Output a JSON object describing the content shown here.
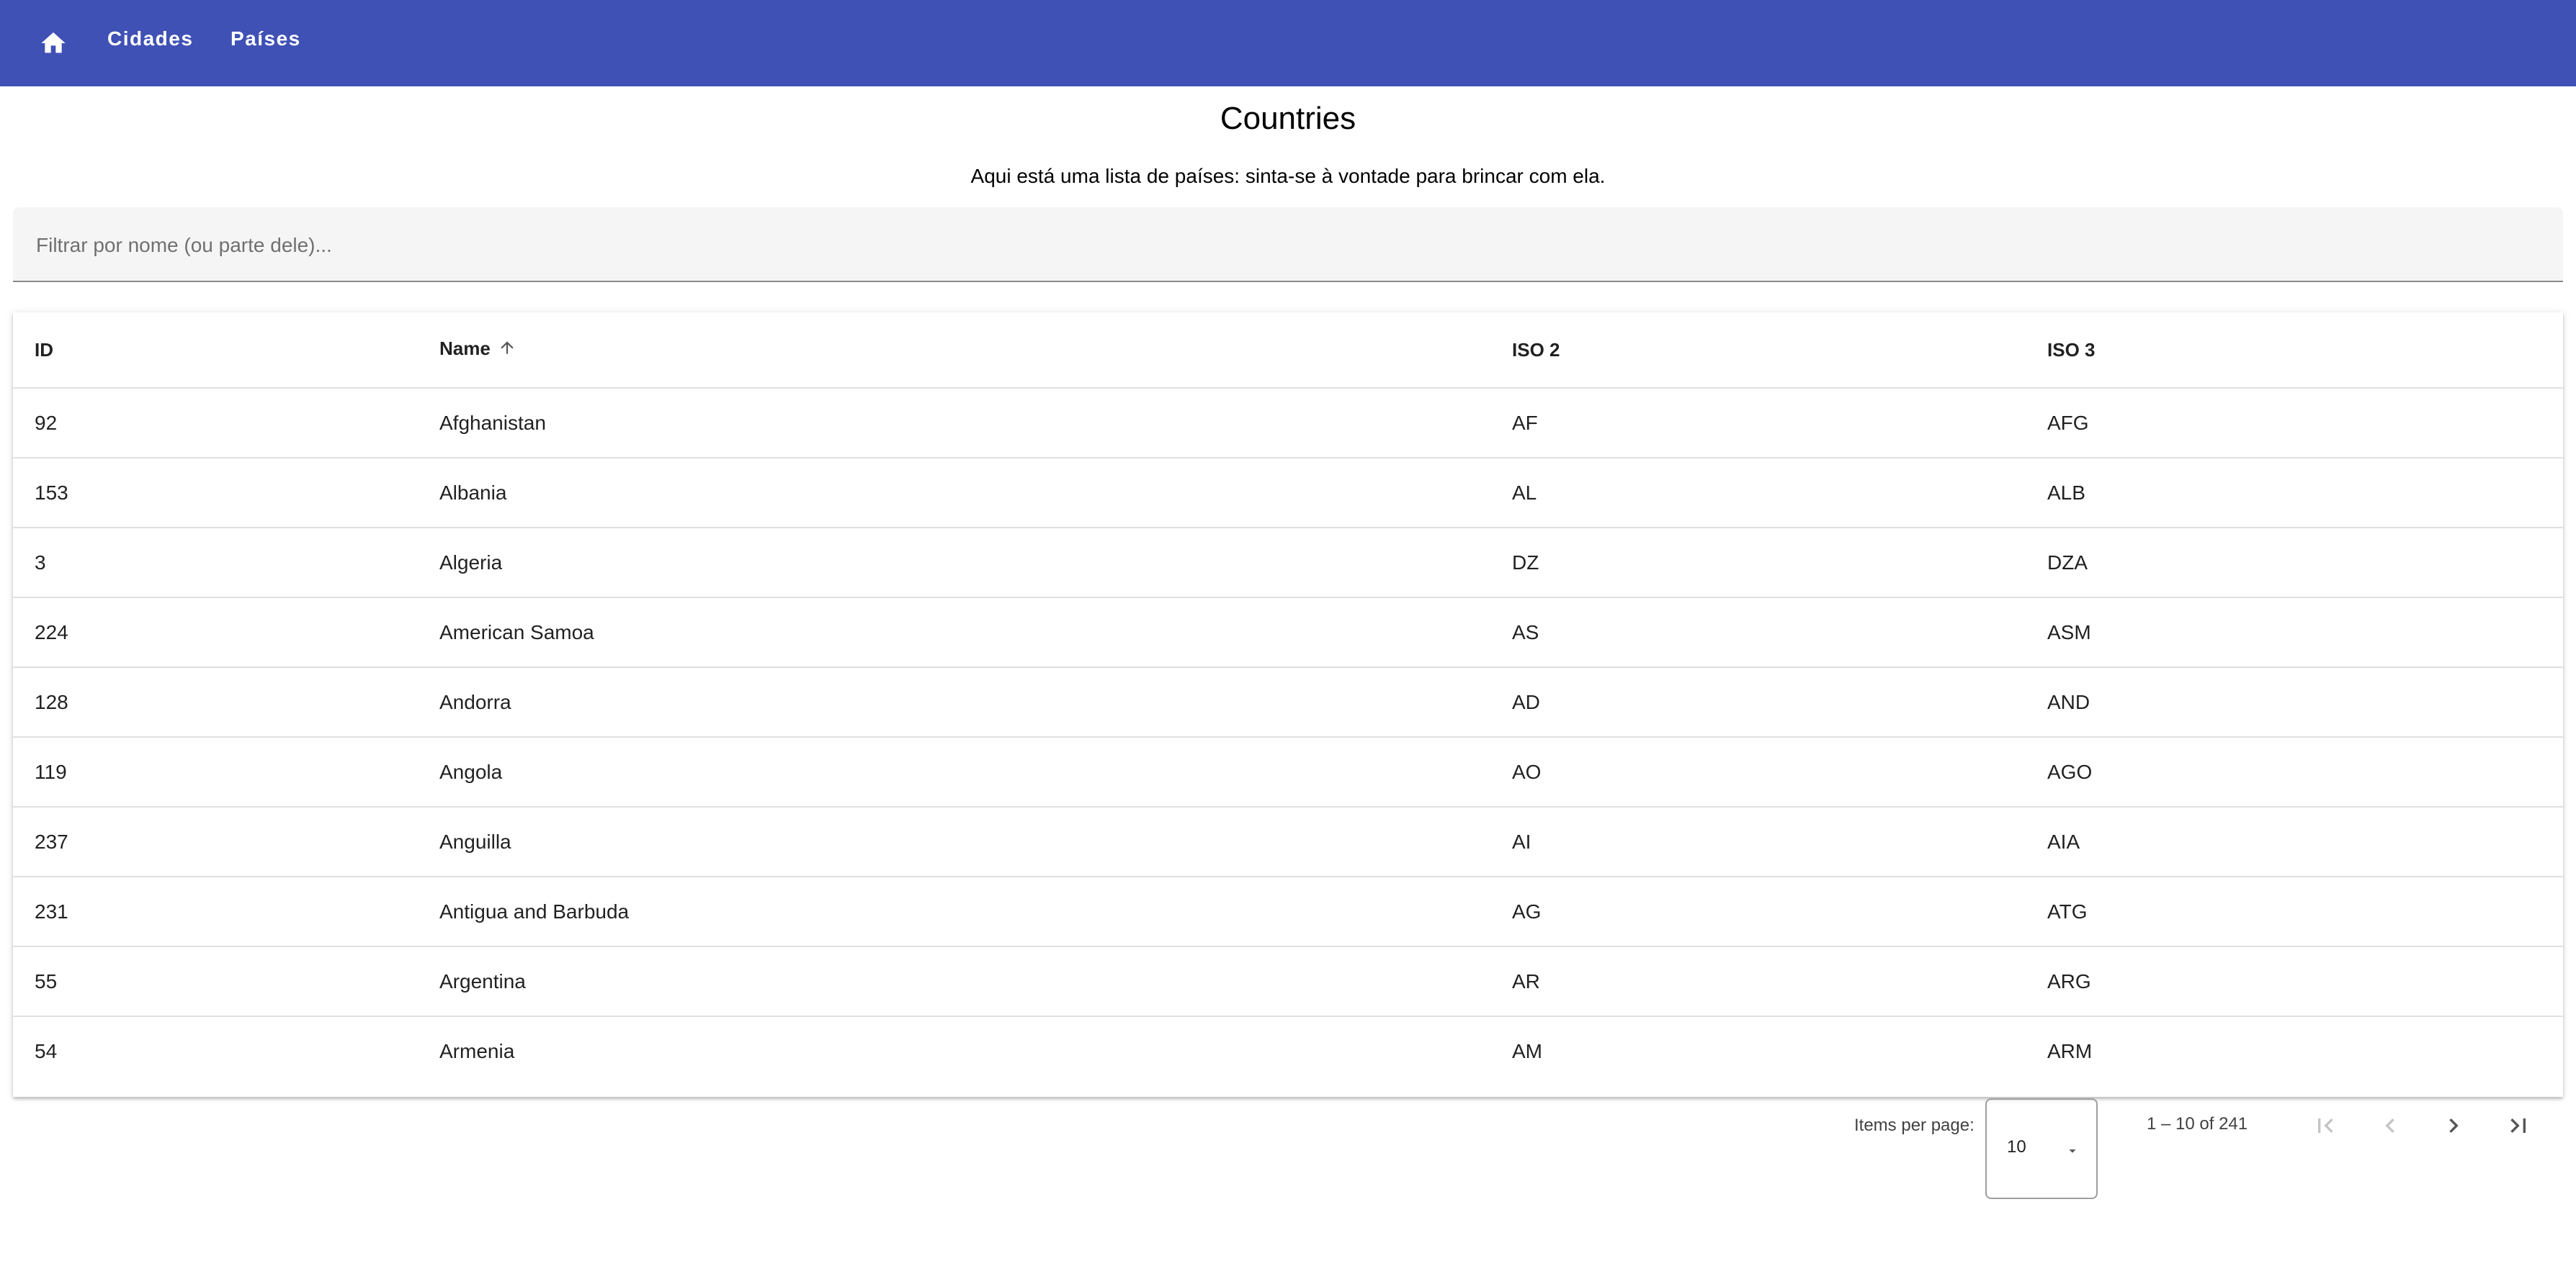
{
  "toolbar": {
    "home_icon": "home-icon",
    "links": [
      {
        "label": "Cidades"
      },
      {
        "label": "Países"
      }
    ]
  },
  "page": {
    "title": "Countries",
    "subtitle": "Aqui está uma lista de países: sinta-se à vontade para brincar com ela."
  },
  "filter": {
    "placeholder": "Filtrar por nome (ou parte dele)...",
    "value": ""
  },
  "table": {
    "columns": [
      "ID",
      "Name",
      "ISO 2",
      "ISO 3"
    ],
    "sort": {
      "column": "Name",
      "direction": "asc",
      "icon": "arrow-up-icon"
    },
    "rows": [
      {
        "id": "92",
        "name": "Afghanistan",
        "iso2": "AF",
        "iso3": "AFG"
      },
      {
        "id": "153",
        "name": "Albania",
        "iso2": "AL",
        "iso3": "ALB"
      },
      {
        "id": "3",
        "name": "Algeria",
        "iso2": "DZ",
        "iso3": "DZA"
      },
      {
        "id": "224",
        "name": "American Samoa",
        "iso2": "AS",
        "iso3": "ASM"
      },
      {
        "id": "128",
        "name": "Andorra",
        "iso2": "AD",
        "iso3": "AND"
      },
      {
        "id": "119",
        "name": "Angola",
        "iso2": "AO",
        "iso3": "AGO"
      },
      {
        "id": "237",
        "name": "Anguilla",
        "iso2": "AI",
        "iso3": "AIA"
      },
      {
        "id": "231",
        "name": "Antigua and Barbuda",
        "iso2": "AG",
        "iso3": "ATG"
      },
      {
        "id": "55",
        "name": "Argentina",
        "iso2": "AR",
        "iso3": "ARG"
      },
      {
        "id": "54",
        "name": "Armenia",
        "iso2": "AM",
        "iso3": "ARM"
      }
    ]
  },
  "paginator": {
    "items_per_page_label": "Items per page:",
    "items_per_page_value": "10",
    "range_label": "1 – 10 of 241"
  },
  "colors": {
    "toolbar": "#3f51b5",
    "filter_bg": "#f5f5f5"
  }
}
